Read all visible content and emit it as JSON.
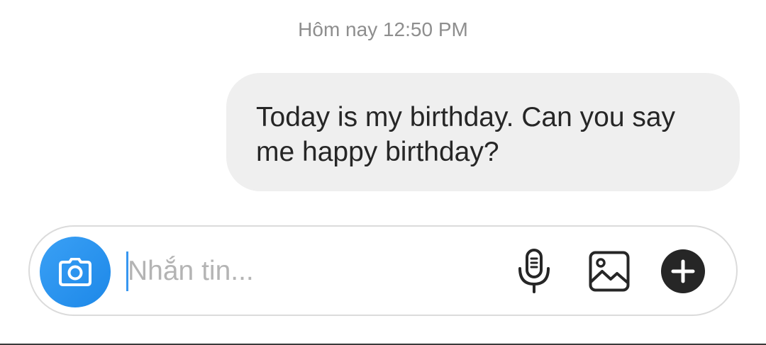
{
  "thread": {
    "timestamp": "Hôm nay 12:50 PM",
    "messages": [
      {
        "sender": "me",
        "text": "Today is my birthday. Can you say me happy birthday?"
      }
    ]
  },
  "composer": {
    "placeholder": "Nhắn tin...",
    "value": "",
    "camera_icon": "camera-icon",
    "mic_icon": "microphone-icon",
    "gallery_icon": "image-icon",
    "more_icon": "plus-icon"
  },
  "colors": {
    "accent": "#1d88e8",
    "bubble_background": "#efefef",
    "timestamp_text": "#8e8e8e",
    "placeholder_text": "#b4b4b4",
    "icon_dark": "#262626"
  }
}
